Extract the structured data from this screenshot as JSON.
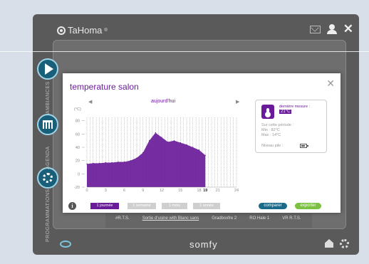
{
  "app": {
    "logo_text": "TaHoma",
    "logo_sup": "®",
    "pager_dots": "● ● ● ● ● ● ●",
    "footer_brand": "somfy",
    "sidebar_labels": [
      "AMBIANCES",
      "AGENDA",
      "PROGRAMMATIONS"
    ],
    "bottom_row": [
      "#R.T.S.",
      "Sortie d'usine with Blanc sans",
      "Gradboxfre 2",
      "RO Hale 1",
      "VR R.T.S."
    ]
  },
  "modal": {
    "title": "temperature salon",
    "period_title": "aujourd'hui",
    "arrow_left": "◀",
    "arrow_right": "▶",
    "close": "✕"
  },
  "card": {
    "last_label": "dernière mesure :",
    "last_value": "21°C",
    "period_label": "Sur cette période :",
    "min": "Min : 82°C",
    "max": "Max : 14°C",
    "battery_label": "Niveau pile :"
  },
  "tabs": [
    {
      "label": "1 journée",
      "active": true
    },
    {
      "label": "1 semaine",
      "active": false
    },
    {
      "label": "1 mois",
      "active": false
    },
    {
      "label": "1 année",
      "active": false
    }
  ],
  "buttons": {
    "compare": "comparer",
    "export": "exporter"
  },
  "colors": {
    "accent": "#6a1b9a",
    "compare": "#1a6b8a",
    "export": "#7bc142"
  },
  "chart_data": {
    "type": "area",
    "ylabel": "(°C)",
    "x": [
      0,
      1,
      2,
      3,
      4,
      5,
      6,
      7,
      8,
      9,
      10,
      11,
      12,
      13,
      14,
      15,
      16,
      17,
      18,
      19
    ],
    "values": [
      15,
      16,
      16,
      17,
      17,
      18,
      18,
      20,
      24,
      32,
      50,
      62,
      55,
      48,
      50,
      47,
      44,
      40,
      36,
      28
    ],
    "xticks": [
      "0",
      "3",
      "6",
      "9",
      "12",
      "15",
      "18",
      "19",
      "21",
      "24"
    ],
    "xtick_values": [
      0,
      3,
      6,
      9,
      12,
      15,
      18,
      19,
      21,
      24
    ],
    "yticks": [
      "80",
      "60",
      "40",
      "20",
      "0",
      "-20"
    ],
    "ytick_values": [
      80,
      60,
      40,
      20,
      0,
      -20
    ],
    "xlim": [
      0,
      24
    ],
    "ylim": [
      -20,
      85
    ],
    "current_hour": 19,
    "grid": true
  }
}
